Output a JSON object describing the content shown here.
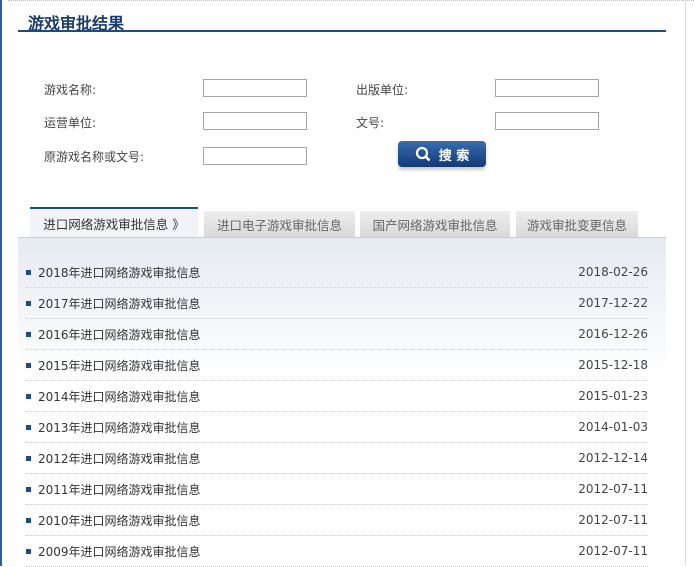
{
  "title": "游戏审批结果",
  "form": {
    "game_name_label": "游戏名称:",
    "publisher_label": "出版单位:",
    "operator_label": "运营单位:",
    "doc_no_label": "文号:",
    "original_label": "原游戏名称或文号:",
    "search_label": "搜 索"
  },
  "tabs": [
    {
      "label": "进口网络游戏审批信息 》"
    },
    {
      "label": "进口电子游戏审批信息"
    },
    {
      "label": "国产网络游戏审批信息"
    },
    {
      "label": "游戏审批变更信息"
    }
  ],
  "items": [
    {
      "title": "2018年进口网络游戏审批信息",
      "date": "2018-02-26"
    },
    {
      "title": "2017年进口网络游戏审批信息",
      "date": "2017-12-22"
    },
    {
      "title": "2016年进口网络游戏审批信息",
      "date": "2016-12-26"
    },
    {
      "title": "2015年进口网络游戏审批信息",
      "date": "2015-12-18"
    },
    {
      "title": "2014年进口网络游戏审批信息",
      "date": "2015-01-23"
    },
    {
      "title": "2013年进口网络游戏审批信息",
      "date": "2014-01-03"
    },
    {
      "title": "2012年进口网络游戏审批信息",
      "date": "2012-12-14"
    },
    {
      "title": "2011年进口网络游戏审批信息",
      "date": "2012-07-11"
    },
    {
      "title": "2010年进口网络游戏审批信息",
      "date": "2012-07-11"
    },
    {
      "title": "2009年进口网络游戏审批信息",
      "date": "2012-07-11"
    }
  ]
}
